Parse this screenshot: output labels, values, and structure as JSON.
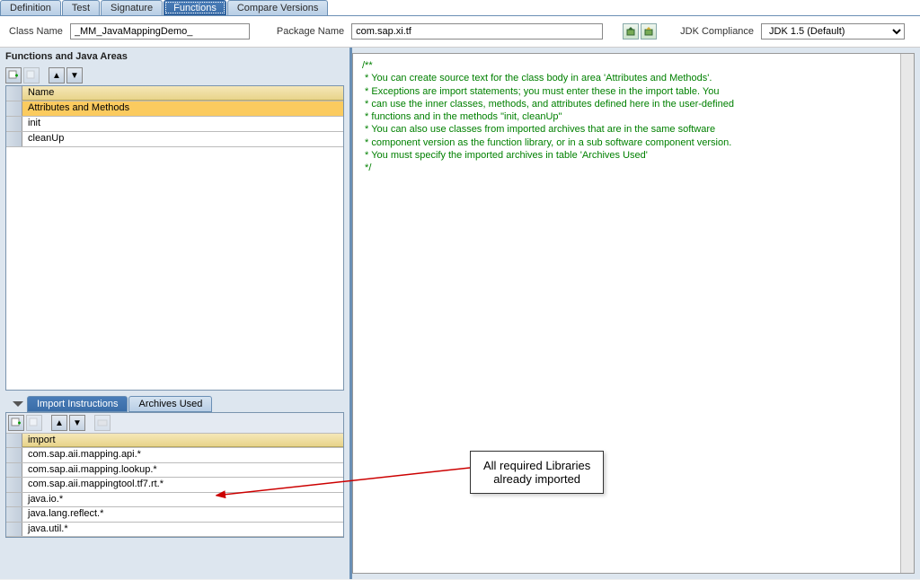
{
  "tabs": {
    "items": [
      "Definition",
      "Test",
      "Signature",
      "Functions",
      "Compare Versions"
    ],
    "active": 3
  },
  "header": {
    "className_label": "Class Name",
    "className_value": "_MM_JavaMappingDemo_",
    "packageName_label": "Package Name",
    "packageName_value": "com.sap.xi.tf",
    "jdk_label": "JDK Compliance",
    "jdk_value": "JDK 1.5 (Default)"
  },
  "functions": {
    "title": "Functions and Java Areas",
    "columnHeader": "Name",
    "rows": [
      "Attributes and Methods",
      "init",
      "cleanUp"
    ],
    "selected": 0
  },
  "bottomTabs": {
    "items": [
      "Import Instructions",
      "Archives Used"
    ],
    "active": 0
  },
  "imports": {
    "columnHeader": "import",
    "rows": [
      "com.sap.aii.mapping.api.*",
      "com.sap.aii.mapping.lookup.*",
      "com.sap.aii.mappingtool.tf7.rt.*",
      "java.io.*",
      "java.lang.reflect.*",
      "java.util.*"
    ]
  },
  "code": {
    "lines": [
      "/**",
      " * You can create source text for the class body in area 'Attributes and Methods'.",
      " * Exceptions are import statements; you must enter these in the import table. You",
      " * can use the inner classes, methods, and attributes defined here in the user-defined",
      " * functions and in the methods \"init, cleanUp\"",
      " * You can also use classes from imported archives that are in the same software",
      " * component version as the function library, or in a sub software component version.",
      " * You must specify the imported archives in table 'Archives Used'",
      " */"
    ]
  },
  "annotation": {
    "line1": "All required Libraries",
    "line2": "already imported"
  }
}
